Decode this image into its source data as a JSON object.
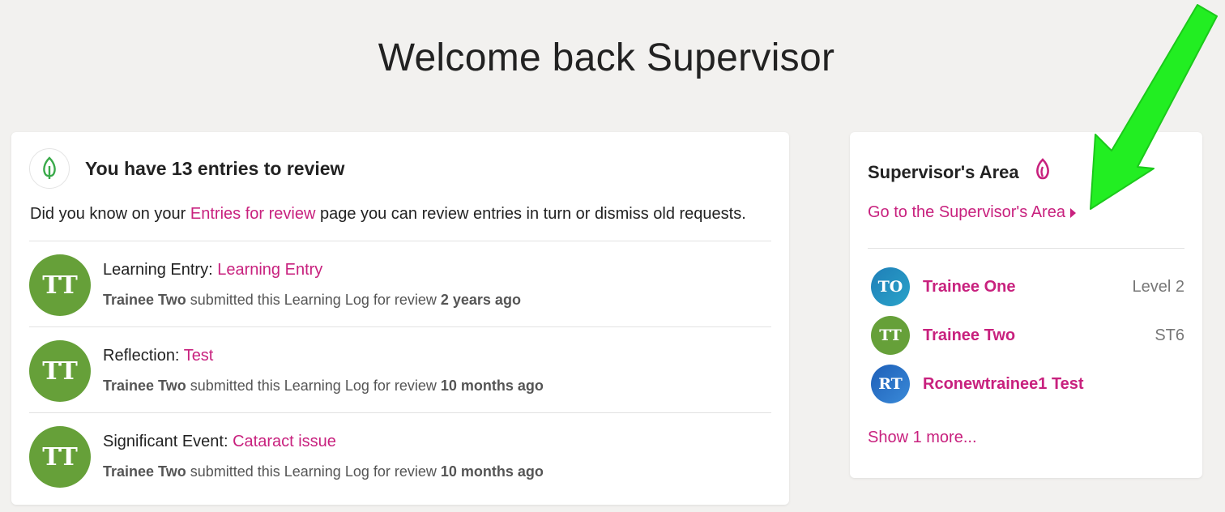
{
  "page": {
    "title": "Welcome back Supervisor"
  },
  "review": {
    "heading": "You have 13 entries to review",
    "hint_prefix": "Did you know on your ",
    "hint_link": "Entries for review",
    "hint_suffix": " page you can review entries in turn or dismiss old requests.",
    "entries": [
      {
        "initials": "TT",
        "type": "Learning Entry: ",
        "link": "Learning Entry",
        "who": "Trainee Two",
        "verb": " submitted this Learning Log for review ",
        "when": "2 years ago"
      },
      {
        "initials": "TT",
        "type": "Reflection: ",
        "link": "Test",
        "who": "Trainee Two",
        "verb": " submitted this Learning Log for review ",
        "when": "10 months ago"
      },
      {
        "initials": "TT",
        "type": "Significant Event: ",
        "link": "Cataract issue",
        "who": "Trainee Two",
        "verb": " submitted this Learning Log for review ",
        "when": "10 months ago"
      }
    ]
  },
  "supervisor_area": {
    "title": "Supervisor's Area",
    "link": "Go to the Supervisor's Area",
    "trainees": [
      {
        "initials": "TO",
        "name": "Trainee One",
        "level": "Level 2",
        "color": "#1f7fb8"
      },
      {
        "initials": "TT",
        "name": "Trainee Two",
        "level": "ST6",
        "color": "#66a039"
      },
      {
        "initials": "RT",
        "name": "Rconewtrainee1 Test",
        "level": "",
        "color": "#2a6fc4"
      }
    ],
    "show_more": "Show 1 more..."
  },
  "colors": {
    "accent": "#c8217e",
    "leaf": "#3aaa4a",
    "annotation_arrow": "#22ee22"
  }
}
